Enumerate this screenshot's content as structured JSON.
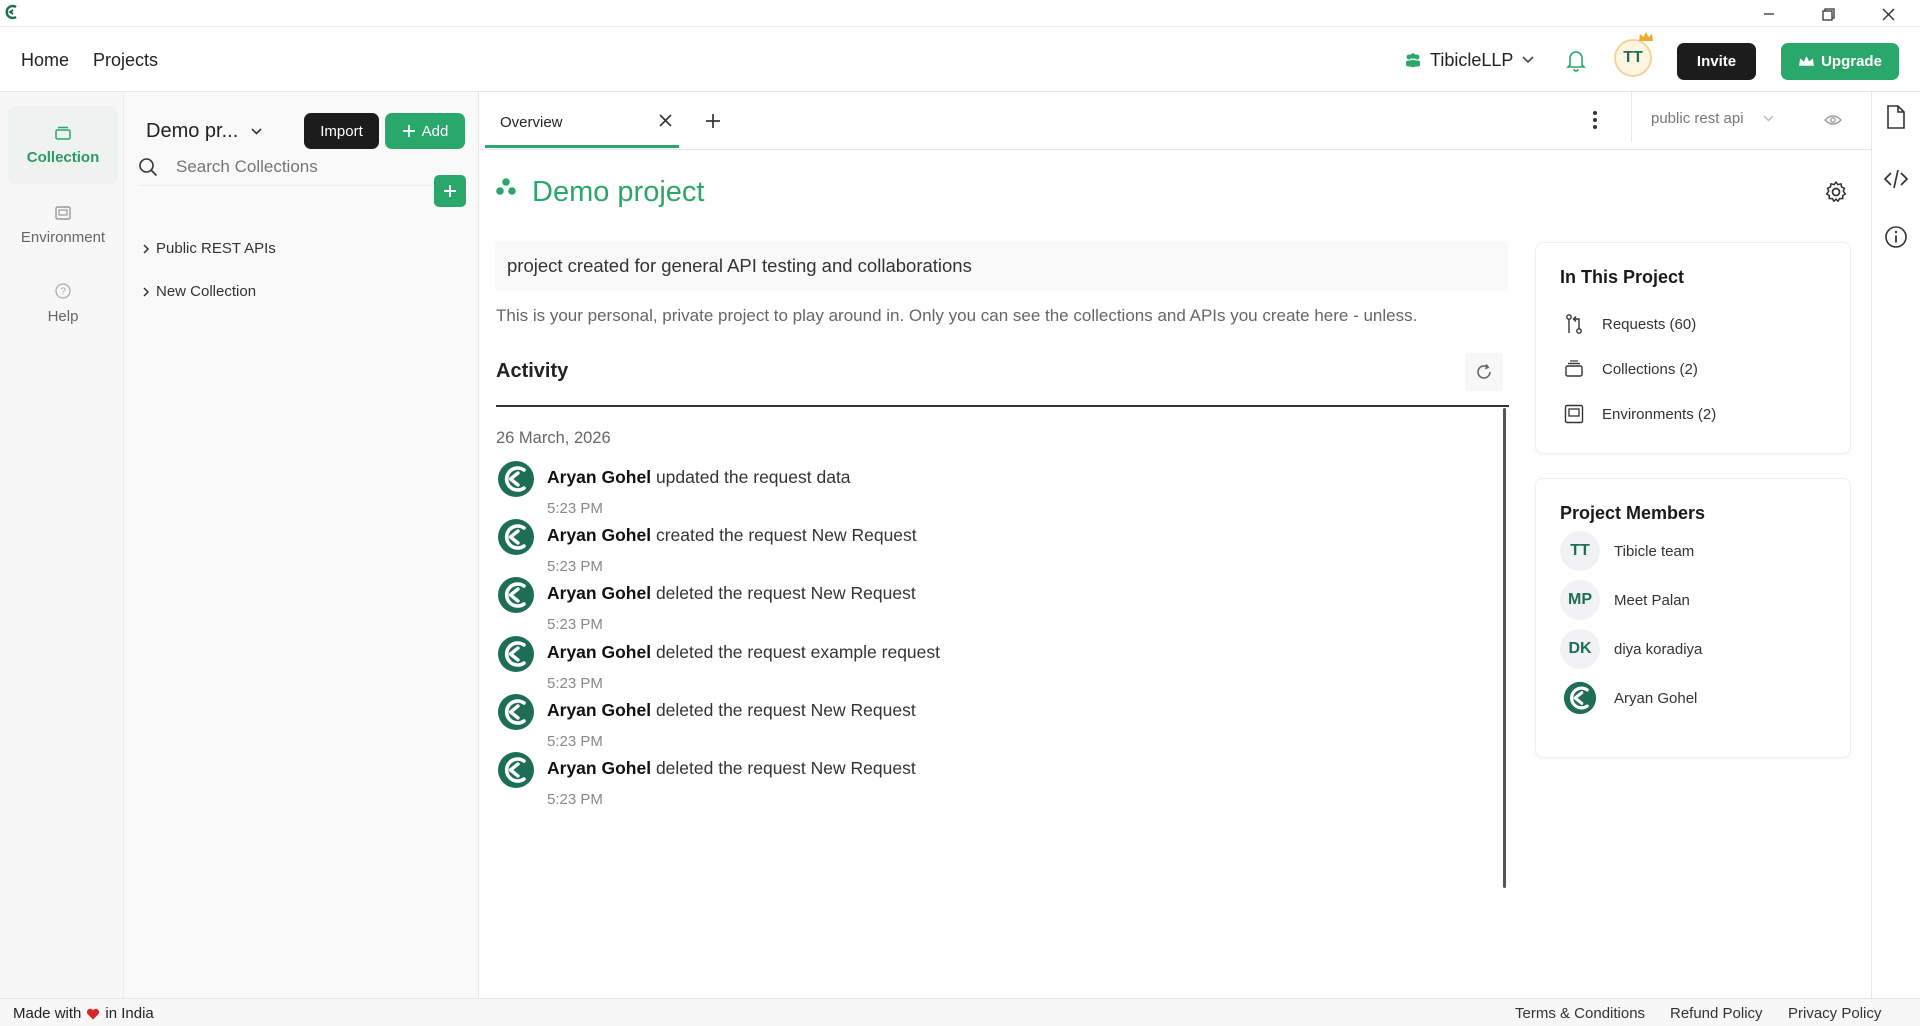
{
  "titlebar": {
    "logo_icon": "app-logo-icon"
  },
  "nav": {
    "home": "Home",
    "projects": "Projects",
    "workspace": "TibicleLLP",
    "avatar_initials": "TT",
    "invite": "Invite",
    "upgrade": "Upgrade"
  },
  "rail": {
    "collection": "Collection",
    "environment": "Environment",
    "help": "Help"
  },
  "panel": {
    "project_select": "Demo pr...",
    "import": "Import",
    "add": "Add",
    "search_placeholder": "Search Collections",
    "collections": [
      {
        "label": "Public REST APIs"
      },
      {
        "label": "New Collection"
      }
    ]
  },
  "tabs": {
    "overview": "Overview",
    "environment_select": "public rest api"
  },
  "project": {
    "title": "Demo project",
    "description": "project created for general API testing and collaborations",
    "note": "This is your personal, private project to play around in. Only you can see the collections and APIs you create here - unless."
  },
  "activity": {
    "heading": "Activity",
    "date": "26 March, 2026",
    "items": [
      {
        "user": "Aryan Gohel",
        "action": "updated the request data",
        "time": "5:23 PM"
      },
      {
        "user": "Aryan Gohel",
        "action": "created the request New Request",
        "time": "5:23 PM"
      },
      {
        "user": "Aryan Gohel",
        "action": "deleted the request New Request",
        "time": "5:23 PM"
      },
      {
        "user": "Aryan Gohel",
        "action": "deleted the request example request",
        "time": "5:23 PM"
      },
      {
        "user": "Aryan Gohel",
        "action": "deleted the request New Request",
        "time": "5:23 PM"
      },
      {
        "user": "Aryan Gohel",
        "action": "deleted the request New Request",
        "time": "5:23 PM"
      }
    ]
  },
  "in_project": {
    "heading": "In This Project",
    "requests": "Requests (60)",
    "collections": "Collections (2)",
    "environments": "Environments (2)"
  },
  "members": {
    "heading": "Project Members",
    "list": [
      {
        "initials": "TT",
        "name": "Tibicle team"
      },
      {
        "initials": "MP",
        "name": "Meet Palan"
      },
      {
        "initials": "DK",
        "name": "diya koradiya"
      },
      {
        "initials": "",
        "name": "Aryan Gohel"
      }
    ]
  },
  "footer": {
    "made_with": "Made with",
    "in_india": "in India",
    "terms": "Terms & Conditions",
    "refund": "Refund Policy",
    "privacy": "Privacy Policy"
  },
  "colors": {
    "accent": "#2aa76a",
    "dark": "#1c1c1c",
    "logo": "#1d6d57"
  }
}
